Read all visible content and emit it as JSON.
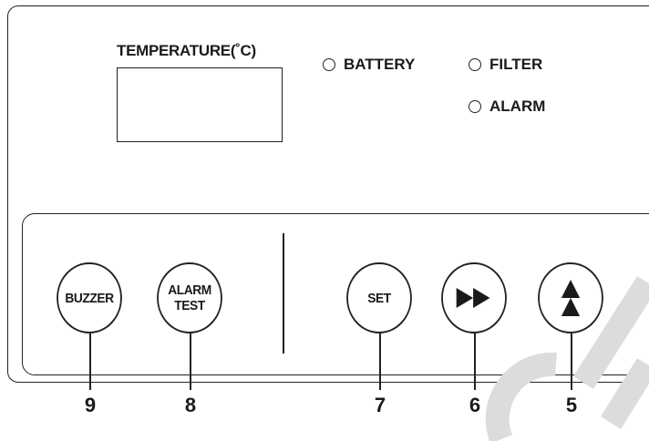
{
  "display": {
    "label": "TEMPERATURE(˚C)"
  },
  "indicators": {
    "battery": "BATTERY",
    "filter": "FILTER",
    "alarm": "ALARM"
  },
  "buttons": {
    "buzzer": "BUZZER",
    "alarm_test_line1": "ALARM",
    "alarm_test_line2": "TEST",
    "set": "SET",
    "fast_forward_icon": "double-right-triangle",
    "up_icon": "double-up-triangle"
  },
  "callouts": {
    "buzzer": "9",
    "alarm_test": "8",
    "set": "7",
    "fast_forward": "6",
    "up": "5"
  }
}
